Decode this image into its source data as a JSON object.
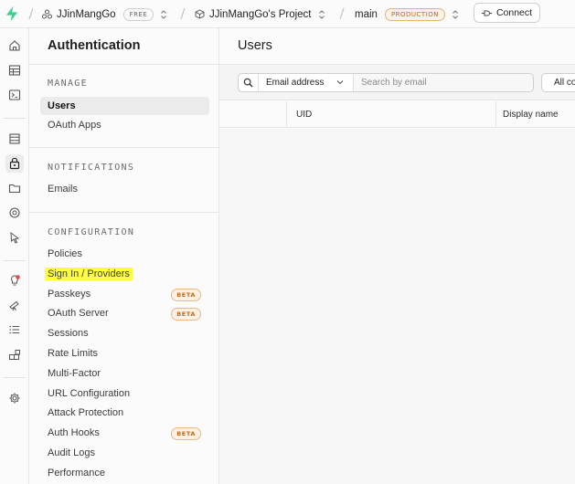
{
  "topbar": {
    "org_name": "JJinMangGo",
    "org_plan": "FREE",
    "project_name": "JJinMangGo's Project",
    "branch_name": "main",
    "branch_env": "PRODUCTION",
    "connect_label": "Connect"
  },
  "rail": {
    "icons": [
      "home-icon",
      "table-editor-icon",
      "sql-editor-icon",
      "database-icon",
      "authentication-icon",
      "storage-icon",
      "realtime-icon",
      "edge-functions-icon",
      "advisors-icon",
      "reports-icon",
      "logs-icon",
      "integrations-icon",
      "settings-icon"
    ],
    "active": "authentication-icon"
  },
  "sidebar": {
    "title": "Authentication",
    "sections": [
      {
        "label": "MANAGE",
        "items": [
          {
            "label": "Users",
            "active": true
          },
          {
            "label": "OAuth Apps"
          }
        ]
      },
      {
        "label": "NOTIFICATIONS",
        "items": [
          {
            "label": "Emails"
          }
        ]
      },
      {
        "label": "CONFIGURATION",
        "items": [
          {
            "label": "Policies"
          },
          {
            "label": "Sign In / Providers",
            "highlighted": true
          },
          {
            "label": "Passkeys",
            "badge": "BETA"
          },
          {
            "label": "OAuth Server",
            "badge": "BETA"
          },
          {
            "label": "Sessions"
          },
          {
            "label": "Rate Limits"
          },
          {
            "label": "Multi-Factor"
          },
          {
            "label": "URL Configuration"
          },
          {
            "label": "Attack Protection"
          },
          {
            "label": "Auth Hooks",
            "badge": "BETA"
          },
          {
            "label": "Audit Logs"
          },
          {
            "label": "Performance"
          }
        ]
      }
    ]
  },
  "main": {
    "title": "Users",
    "search": {
      "field_selector": "Email address",
      "placeholder": "Search by email",
      "filter_label": "All co"
    },
    "table": {
      "columns": [
        "UID",
        "Display name"
      ]
    }
  },
  "colors": {
    "brand": "#3ecf8e",
    "highlight": "#ffff3d",
    "beta_badge": "#c06a1c"
  }
}
